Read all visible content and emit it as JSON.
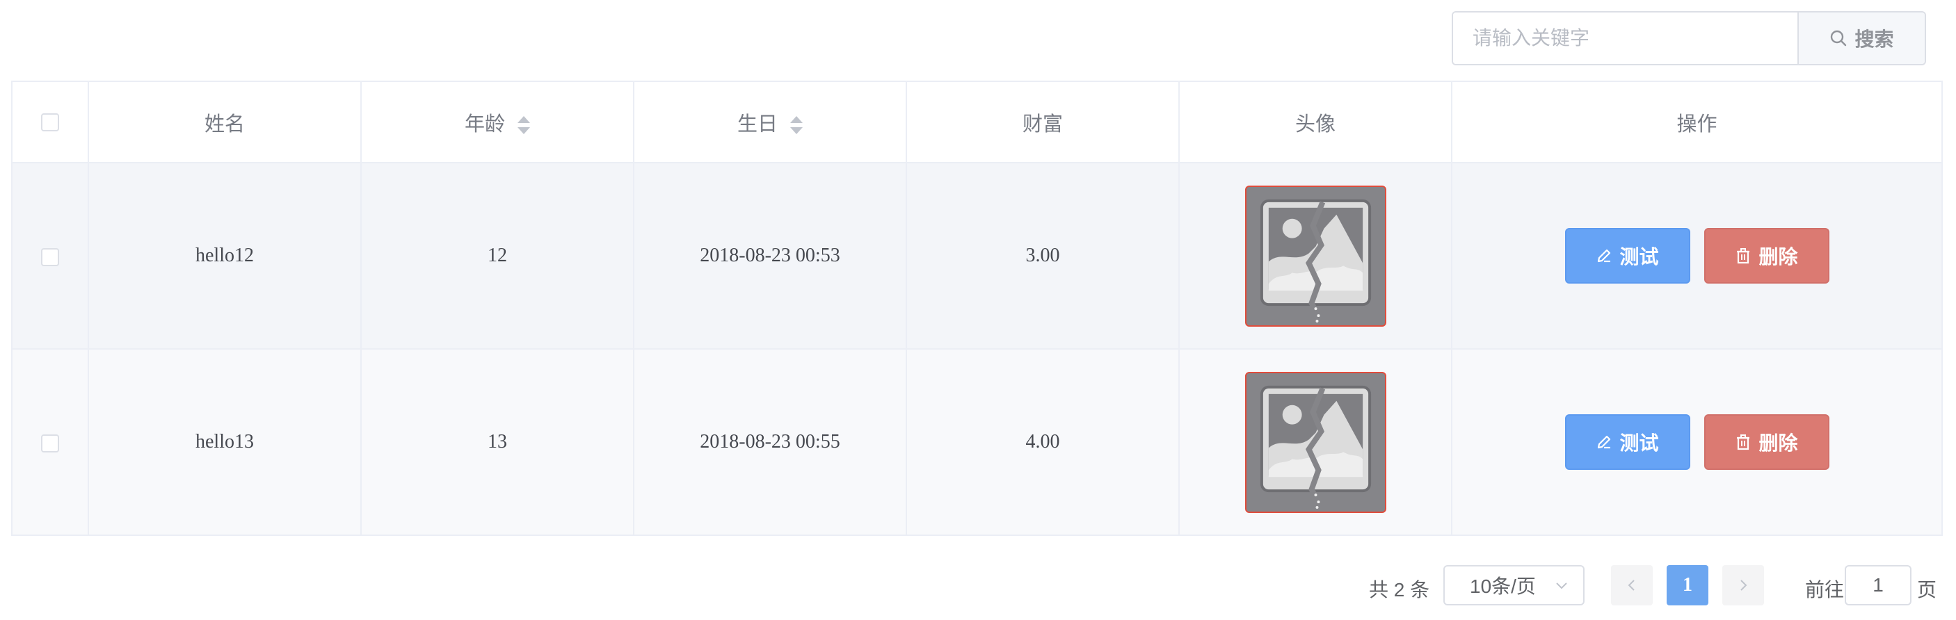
{
  "search": {
    "placeholder": "请输入关键字",
    "button_label": "搜索",
    "button_icon": "search-icon"
  },
  "table": {
    "columns": [
      {
        "key": "select",
        "label": ""
      },
      {
        "key": "name",
        "label": "姓名"
      },
      {
        "key": "age",
        "label": "年龄",
        "sortable": true
      },
      {
        "key": "birthday",
        "label": "生日",
        "sortable": true
      },
      {
        "key": "wealth",
        "label": "财富"
      },
      {
        "key": "avatar",
        "label": "头像"
      },
      {
        "key": "actions",
        "label": "操作"
      }
    ],
    "rows": [
      {
        "name": "hello12",
        "age": "12",
        "birthday": "2018-08-23 00:53",
        "wealth": "3.00",
        "avatar": "broken-image-icon"
      },
      {
        "name": "hello13",
        "age": "13",
        "birthday": "2018-08-23 00:55",
        "wealth": "4.00",
        "avatar": "broken-image-icon"
      }
    ],
    "actions": {
      "test_label": "测试",
      "test_icon": "edit-icon",
      "delete_label": "删除",
      "delete_icon": "trash-icon"
    }
  },
  "pagination": {
    "total_text": "共 2 条",
    "page_size": "10条/页",
    "current_page": "1",
    "goto_label": "前往",
    "goto_value": "1",
    "page_word": "页"
  },
  "colors": {
    "primary": "#66a3f5",
    "danger": "#db7a72",
    "border": "#ebeef5",
    "row_stripe": "#f3f5f9"
  }
}
